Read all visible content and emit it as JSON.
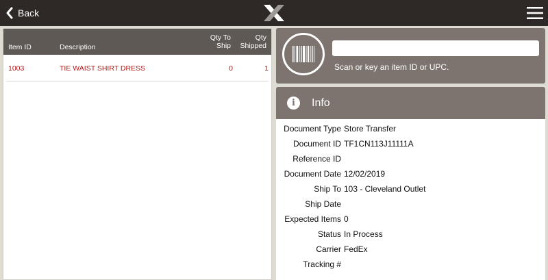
{
  "topbar": {
    "back_label": "Back"
  },
  "items_table": {
    "headers": {
      "item_id": "Item ID",
      "description": "Description",
      "qty_to_ship_line1": "Qty To",
      "qty_to_ship_line2": "Ship",
      "qty_shipped_line1": "Qty",
      "qty_shipped_line2": "Shipped"
    },
    "rows": [
      {
        "item_id": "1003",
        "description": "TIE WAIST SHIRT DRESS",
        "qty_to_ship": "0",
        "qty_shipped": "1"
      }
    ]
  },
  "scan": {
    "input_value": "",
    "input_placeholder": "",
    "hint": "Scan or key an item ID or UPC."
  },
  "info": {
    "title": "Info",
    "fields": [
      {
        "label": "Document Type",
        "value": "Store Transfer"
      },
      {
        "label": "Document ID",
        "value": "TF1CN113J11111A"
      },
      {
        "label": "Reference ID",
        "value": ""
      },
      {
        "label": "Document Date",
        "value": "12/02/2019"
      },
      {
        "label": "Ship To",
        "value": "103 - Cleveland Outlet"
      },
      {
        "label": "Ship Date",
        "value": ""
      },
      {
        "label": "Expected Items",
        "value": "0"
      },
      {
        "label": "Status",
        "value": "In Process"
      },
      {
        "label": "Carrier",
        "value": "FedEx"
      },
      {
        "label": "Tracking #",
        "value": ""
      }
    ]
  },
  "colors": {
    "topbar": "#2e2926",
    "panel_header": "#7d7470",
    "table_header": "#5e5955",
    "item_text": "#b01818",
    "background": "#dddbd2"
  },
  "icons": {
    "back": "chevron-left-icon",
    "logo": "x-logo-icon",
    "menu": "hamburger-menu-icon",
    "scan": "barcode-icon",
    "info": "info-icon"
  }
}
